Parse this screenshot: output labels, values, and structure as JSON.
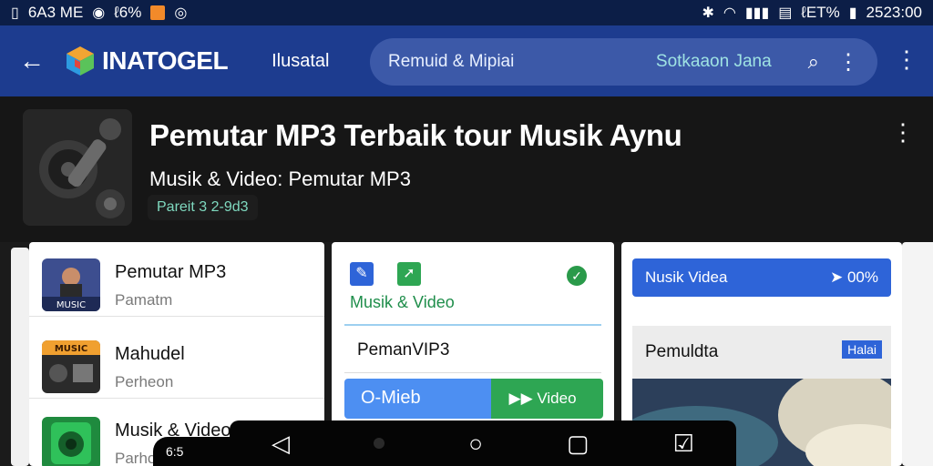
{
  "status_bar": {
    "left_text": "6A3 ME",
    "battery_text": "ℓ6%",
    "right_text": "ℓET%",
    "time": "2523:00"
  },
  "app_bar": {
    "brand": "INATOGEL",
    "nav_label": "Ilusatal",
    "search_query": "Remuid & Mipiai",
    "sort_label": "Sotkaaon Jana"
  },
  "hero": {
    "title": "Pemutar MP3 Terbaik tour Musik Aynu",
    "subtitle": "Musik & Video: Pemutar MP3",
    "chip": "Pareit 3 2-9d3"
  },
  "list": [
    {
      "title": "Pemutar MP3",
      "subtitle": "Pamatm",
      "thumb_label": "MUSIC"
    },
    {
      "title": "Mahudel",
      "subtitle": "Perheon",
      "thumb_label": "MUSIC"
    },
    {
      "title": "Musik & Video",
      "subtitle": "Parhor"
    }
  ],
  "card2": {
    "category": "Musik & Video",
    "item": "PemanVIP3",
    "button_primary": "O-Mieb",
    "button_secondary": "Video"
  },
  "card3": {
    "bar_label": "Nusik Videa",
    "bar_value": "00%",
    "panel_label": "Pemuldta",
    "badge": "Halai"
  },
  "nav": {
    "left_chip": "6:5"
  },
  "colors": {
    "status_bar": "#0c1e47",
    "app_bar": "#1d3c8f",
    "search": "#3c59a8",
    "accent_blue": "#4d8ff2",
    "accent_green": "#2ea653"
  }
}
